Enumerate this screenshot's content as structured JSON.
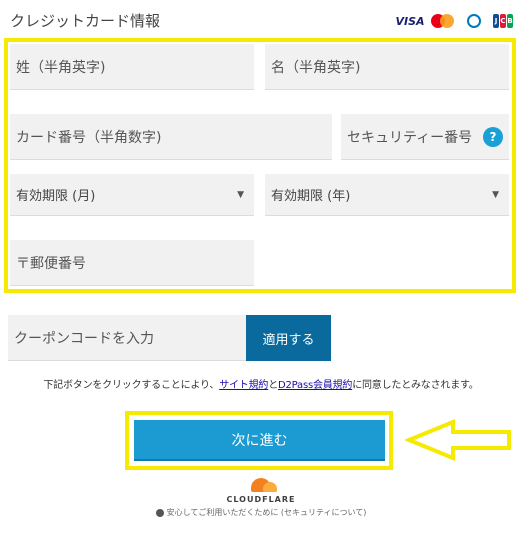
{
  "header": {
    "title": "クレジットカード情報"
  },
  "card_brands": [
    "VISA",
    "Mastercard",
    "Diners Club",
    "JCB"
  ],
  "form": {
    "last_name_placeholder": "姓（半角英字)",
    "first_name_placeholder": "名（半角英字)",
    "card_number_placeholder": "カード番号（半角数字)",
    "security_code_placeholder": "セキュリティー番号",
    "help_label": "?",
    "exp_month_label": "有効期限 (月)",
    "exp_year_label": "有効期限 (年)",
    "postal_code_placeholder": "〒郵便番号"
  },
  "coupon": {
    "placeholder": "クーポンコードを入力",
    "apply_label": "適用する"
  },
  "agreement": {
    "prefix": "下記ボタンをクリックすることにより、",
    "site_terms": "サイト規約",
    "and": "と",
    "member_terms": "D2Pass会員規約",
    "suffix": "に同意したとみなされます。"
  },
  "submit_label": "次に進む",
  "cloudflare": {
    "brand": "CLOUDFLARE",
    "note": "安心してご利用いただくために (セキュリティについて)"
  },
  "colors": {
    "highlight": "#f5ea00",
    "primary_button": "#1b9bd1",
    "apply_button": "#0a6a9e",
    "field_bg": "#f1f1f1"
  }
}
